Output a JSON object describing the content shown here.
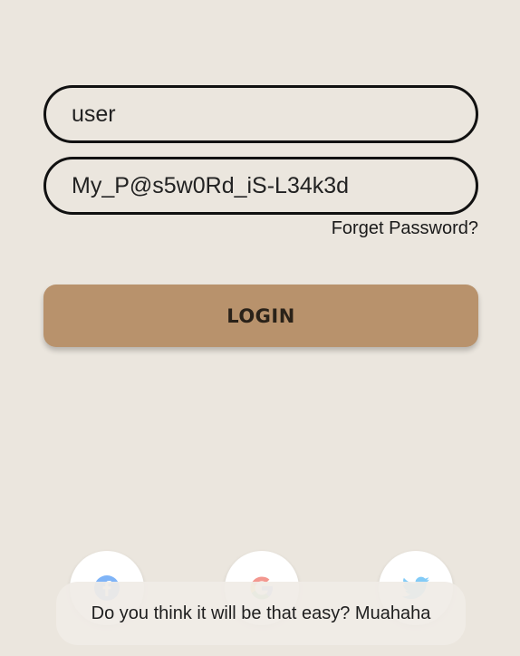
{
  "login_form": {
    "username_value": "user",
    "password_value": "My_P@s5w0Rd_iS-L34k3d",
    "forgot_password_label": "Forget Password?",
    "login_button_label": "LOGIN"
  },
  "social_login": [
    {
      "provider": "facebook",
      "icon": "facebook-icon",
      "color": "#1877f2"
    },
    {
      "provider": "google",
      "icon": "google-icon",
      "color": "#ea4335"
    },
    {
      "provider": "twitter",
      "icon": "twitter-icon",
      "color": "#1da1f2"
    }
  ],
  "toast": {
    "message": "Do you think it will be that easy? Muahaha"
  },
  "colors": {
    "background": "#ebe6de",
    "login_button": "#b8926c",
    "field_border": "#111111"
  }
}
